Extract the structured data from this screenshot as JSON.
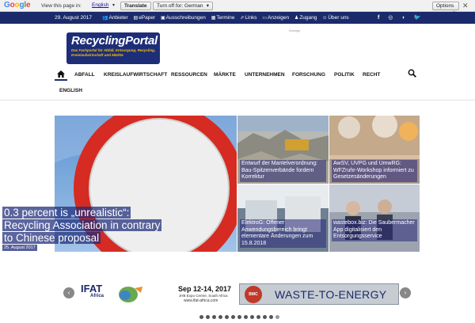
{
  "translate_bar": {
    "view_label": "View this page in:",
    "language": "English",
    "translate_button": "Translate",
    "turn_off_button": "Turn off for: German",
    "options_button": "Options"
  },
  "topbar": {
    "date": "29. August 2017",
    "nav": [
      {
        "label": "Anbieter",
        "icon": "users-icon"
      },
      {
        "label": "ePaper",
        "icon": "book-icon"
      },
      {
        "label": "Ausschreibungen",
        "icon": "document-icon"
      },
      {
        "label": "Termine",
        "icon": "calendar-icon"
      },
      {
        "label": "Links",
        "icon": "external-link-icon"
      },
      {
        "label": "Anzeigen",
        "icon": "laptop-icon"
      },
      {
        "label": "Zugang",
        "icon": "user-icon"
      },
      {
        "label": "Über uns",
        "icon": "person-icon"
      }
    ],
    "social": [
      "facebook-icon",
      "instagram-icon",
      "rss-icon",
      "twitter-icon"
    ]
  },
  "header": {
    "logo_title": "RecyclingPortal",
    "logo_subtitle": "Das Fachportal für Abfall, Entsorgung, Recycling, Kreislaufwirtschaft und Märkte",
    "ad_label": "Anzeige"
  },
  "mainnav": {
    "items": [
      "ABFALL",
      "KREISLAUFWIRTSCHAFT",
      "RESSOURCEN",
      "MÄRKTE",
      "UNTERNEHMEN",
      "FORSCHUNG",
      "POLITIK",
      "RECHT",
      "ENGLISH"
    ]
  },
  "hero": {
    "title": "0.3 percent is „unrealistic“: Recycling Association in contrary to Chinese proposal",
    "date": "25. August 2017"
  },
  "tiles": [
    {
      "text": "Entwurf der Mantelverordnung: Bau-Spitzenverbände fordern Korrektur"
    },
    {
      "text": "AwSV, UVPG und UmwRG: WFZruhr-Workshop informiert zu Gesetzesänderungen"
    },
    {
      "text": "ElektroG: Offener Anwendungsbereich bringt elementare Änderungen zum 15.8.2018"
    },
    {
      "text": "wastebox.biz: Die Saubermacher App digitalisiert den Entsorgungsservice"
    }
  ],
  "banner": {
    "ifat_brand": "IFAT",
    "ifat_region": "Africa",
    "dates": "Sep 12-14, 2017",
    "venue": "JHB Expo Centre, South Africa",
    "url": "www.ifat-africa.com",
    "bmc_label": "BMC",
    "slogan": "WASTE-TO-ENERGY"
  },
  "carousel": {
    "dots": 13,
    "active_index": 12
  },
  "colors": {
    "brand_blue": "#1b2a6b",
    "logo_yellow": "#f5c400"
  }
}
